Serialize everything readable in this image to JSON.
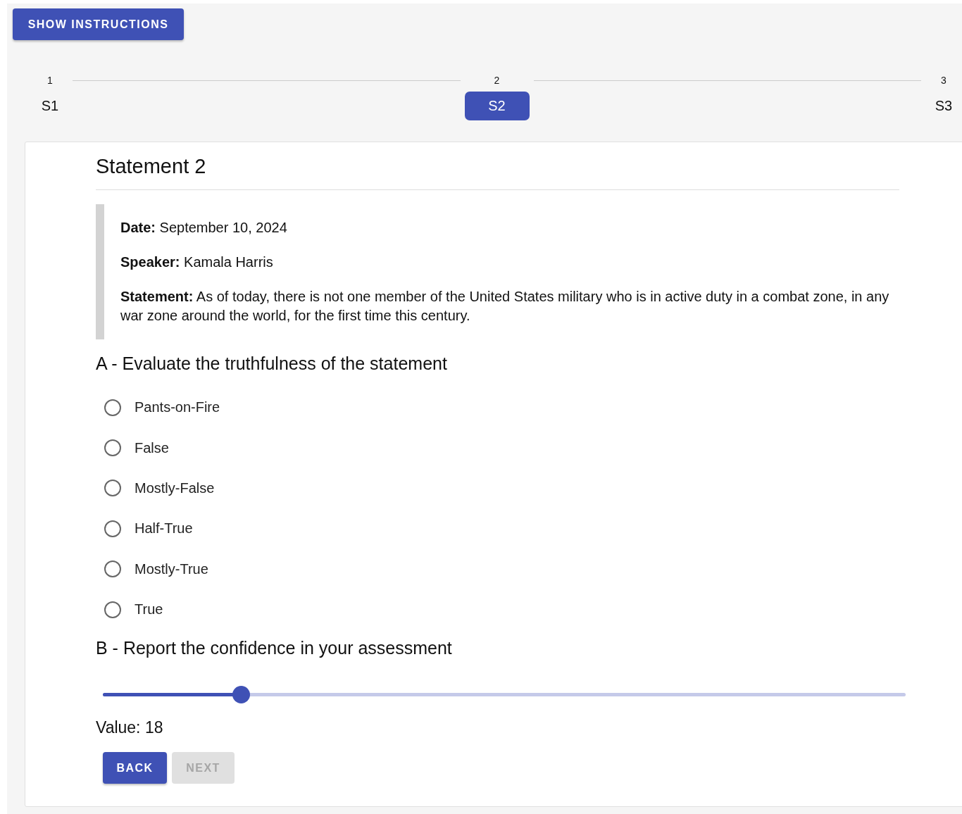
{
  "instructions_button": "SHOW INSTRUCTIONS",
  "steps": [
    {
      "number": "1",
      "label": "S1",
      "selected": false
    },
    {
      "number": "2",
      "label": "S2",
      "selected": true
    },
    {
      "number": "3",
      "label": "S3",
      "selected": false
    }
  ],
  "card": {
    "title": "Statement 2",
    "details": [
      {
        "text": "**Date:** September 10, 2024"
      },
      {
        "text": "**Speaker:** Kamala Harris"
      },
      {
        "text": "**Statement:** As of today, there is not one member of the United States military who is in active duty in a combat zone, in any war zone around the world, for the first time this century."
      }
    ],
    "question_a": {
      "title": "A - Evaluate the truthfulness of the statement",
      "options": [
        {
          "label": "Pants-on-Fire",
          "selected": false
        },
        {
          "label": "False",
          "selected": false
        },
        {
          "label": "Mostly-False",
          "selected": false
        },
        {
          "label": "Half-True",
          "selected": false
        },
        {
          "label": "Mostly-True",
          "selected": false
        },
        {
          "label": "True",
          "selected": false
        }
      ]
    },
    "question_b": {
      "title": "B - Report the confidence in your assessment",
      "slider": {
        "level": 0.172
      },
      "value_text": "Value: 18"
    },
    "buttons": [
      {
        "label": "BACK",
        "disabled": false
      },
      {
        "label": "NEXT",
        "disabled": true
      }
    ]
  }
}
